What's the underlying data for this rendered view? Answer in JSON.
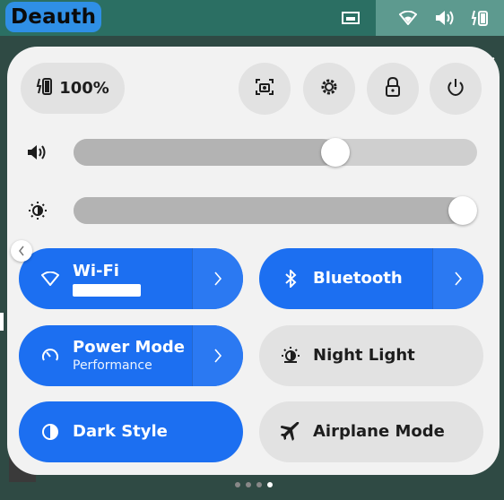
{
  "topbar": {
    "app_label": "Deauth",
    "icons": [
      "screen-icon",
      "wifi-icon",
      "volume-icon",
      "battery-icon"
    ]
  },
  "panel": {
    "battery": {
      "label": "100%",
      "icon": "battery-icon"
    },
    "circle_buttons": [
      "screenshot-icon",
      "settings-icon",
      "lock-icon",
      "power-icon"
    ],
    "volume": {
      "icon": "volume-icon",
      "level": 0.66
    },
    "brightness": {
      "icon": "brightness-icon",
      "level": 1.0
    },
    "tiles": [
      {
        "id": "wifi",
        "title": "Wi-Fi",
        "subtitle": "",
        "on": true,
        "arrow": true,
        "icon": "wifi-icon"
      },
      {
        "id": "bluetooth",
        "title": "Bluetooth",
        "subtitle": "",
        "on": true,
        "arrow": true,
        "icon": "bluetooth-icon"
      },
      {
        "id": "power-mode",
        "title": "Power Mode",
        "subtitle": "Performance",
        "on": true,
        "arrow": true,
        "icon": "power-mode-icon"
      },
      {
        "id": "night-light",
        "title": "Night Light",
        "subtitle": "",
        "on": false,
        "arrow": false,
        "icon": "night-light-icon"
      },
      {
        "id": "dark-style",
        "title": "Dark Style",
        "subtitle": "",
        "on": true,
        "arrow": false,
        "icon": "dark-style-icon"
      },
      {
        "id": "airplane",
        "title": "Airplane Mode",
        "subtitle": "",
        "on": false,
        "arrow": false,
        "icon": "airplane-icon"
      }
    ]
  },
  "colors": {
    "accent": "#1c6ff1",
    "tile_off": "#e2e2e2",
    "panel": "#f2f2f2"
  },
  "pager": {
    "count": 4,
    "active": 3
  }
}
